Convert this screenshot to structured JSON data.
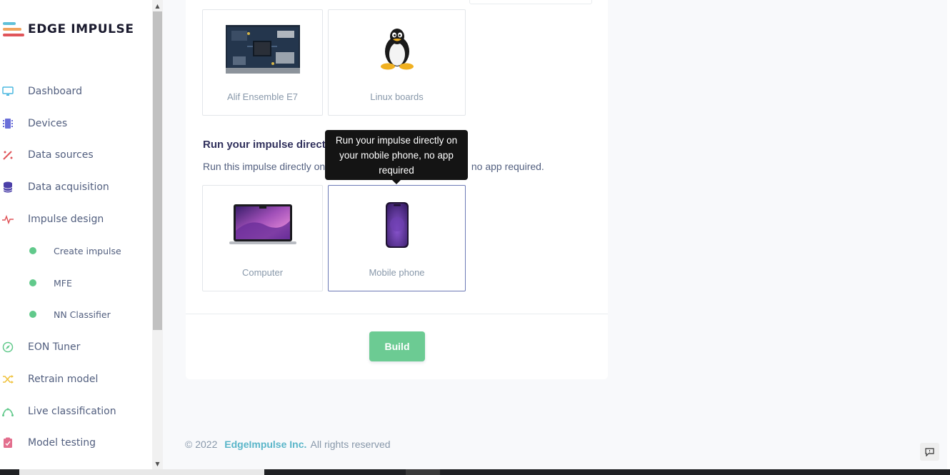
{
  "brand": {
    "name": "EDGE IMPULSE",
    "colors": {
      "bar1": "#5fc0d8",
      "bar2": "#f0a35e",
      "bar3": "#e0555a"
    }
  },
  "sidebar": {
    "items": [
      {
        "label": "Dashboard",
        "icon": "monitor-icon",
        "color": "#4cb8e0"
      },
      {
        "label": "Devices",
        "icon": "chip-icon",
        "color": "#6a6ed8"
      },
      {
        "label": "Data sources",
        "icon": "wand-icon",
        "color": "#e0555a"
      },
      {
        "label": "Data acquisition",
        "icon": "database-icon",
        "color": "#4b3fa8"
      },
      {
        "label": "Impulse design",
        "icon": "pulse-icon",
        "color": "#e0555a"
      },
      {
        "label": "Create impulse",
        "sub": true
      },
      {
        "label": "MFE",
        "sub": true
      },
      {
        "label": "NN Classifier",
        "sub": true
      },
      {
        "label": "EON Tuner",
        "icon": "compass-icon",
        "color": "#61c98b"
      },
      {
        "label": "Retrain model",
        "icon": "shuffle-icon",
        "color": "#f0c23e"
      },
      {
        "label": "Live classification",
        "icon": "curve-icon",
        "color": "#61c98b"
      },
      {
        "label": "Model testing",
        "icon": "clipboard-check-icon",
        "color": "#e36f8e"
      }
    ]
  },
  "deploy": {
    "boards": [
      {
        "label": "Alif Ensemble E7",
        "icon": "circuit-board-icon"
      },
      {
        "label": "Linux boards",
        "icon": "linux-tux-icon"
      }
    ],
    "direct_title": "Run your impulse directly",
    "direct_desc": "Run this impulse directly on your mobile phone or computer, no app required.",
    "direct": [
      {
        "label": "Computer",
        "icon": "laptop-icon"
      },
      {
        "label": "Mobile phone",
        "icon": "phone-icon",
        "selected": true
      }
    ],
    "tooltip": "Run your impulse directly on your mobile phone, no app required",
    "build_label": "Build"
  },
  "footer": {
    "copyright": "© 2022",
    "company": "EdgeImpulse Inc.",
    "rights": "All rights reserved"
  }
}
